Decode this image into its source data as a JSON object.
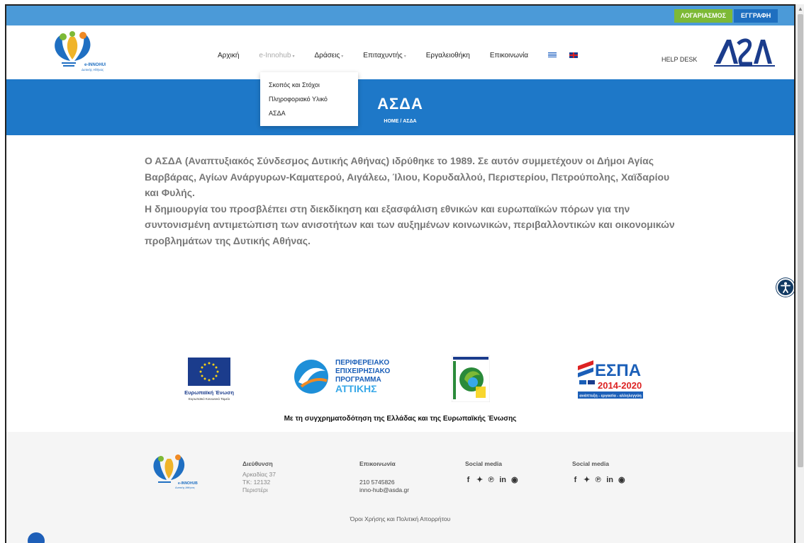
{
  "topbar": {
    "account_label": "ΛΟΓΑΡΙΑΣΜΟΣ",
    "register_label": "ΕΓΓΡΑΦΗ"
  },
  "header": {
    "logo_text": "e-INNOHUB",
    "logo_subtext": "Δυτικής Αθήνας",
    "nav": [
      {
        "label": "Αρχική"
      },
      {
        "label": "e-Innohub"
      },
      {
        "label": "Δράσεις"
      },
      {
        "label": "Επιταχυντής"
      },
      {
        "label": "Εργαλειοθήκη"
      },
      {
        "label": "Επικοινωνία"
      }
    ],
    "helpdesk_label": "HELP DESK",
    "partner_logo_text": "ΑΣΔΑ"
  },
  "dropdown": {
    "items": [
      "Σκοπός και Στόχοι",
      "Πληροφοριακό Υλικό",
      "ΑΣΔΑ"
    ]
  },
  "hero": {
    "title": "ΑΣΔΑ",
    "breadcrumb": "HOME / ΑΣΔΑ"
  },
  "content": {
    "paragraph1": "Ο ΑΣΔΑ (Αναπτυξιακός Σύνδεσμος Δυτικής Αθήνας) ιδρύθηκε το 1989. Σε αυτόν συμμετέχουν οι Δήμοι Αγίας Βαρβάρας, Αγίων Ανάργυρων-Καματερού, Αιγάλεω, Ίλιου, Κορυδαλλού, Περιστερίου, Πετρούπολης, Χαϊδαρίου και Φυλής.",
    "paragraph2": "Η δημιουργία του προσβλέπει στη διεκδίκηση και εξασφάλιση εθνικών και ευρωπαϊκών πόρων για την συντονισμένη αντιμετώπιση των ανισοτήτων και των αυξημένων κοινωνικών, περιβαλλοντικών και οικονομικών προβλημάτων της Δυτικής Αθήνας."
  },
  "sponsors": {
    "eu_title": "Ευρωπαϊκή Ένωση",
    "eu_subtitle": "Ευρωπαϊκό Κοινωνικό Ταμείο",
    "pep_line1": "ΠΕΡΙΦΕΡΕΙΑΚΟ",
    "pep_line2": "ΕΠΙΧΕΙΡΗΣΙΑΚΟ",
    "pep_line3": "ΠΡΟΓΡΑΜΜΑ",
    "pep_line4": "ΑΤΤΙΚΗΣ",
    "espa_title": "ΕΣΠΑ",
    "espa_years": "2014-2020",
    "espa_tagline": "ανάπτυξη - εργασία - αλληλεγγύη",
    "cofund_text": "Με τη συγχρηματοδότηση της Ελλάδας και της Ευρωπαϊκής Ένωσης"
  },
  "footer": {
    "address": {
      "heading": "Διεύθυνση",
      "lines": [
        "Αρκαδίας 37",
        "ΤΚ: 12132",
        "Περιστέρι"
      ]
    },
    "contact": {
      "heading": "Επικοινωνία",
      "phone": "210 5745826",
      "email": "inno-hub@asda.gr"
    },
    "social1": {
      "heading": "Social media"
    },
    "social2": {
      "heading": "Social media"
    },
    "terms": "Όροι Χρήσης και Πολιτική Απορρήτου"
  },
  "colors": {
    "topbar": "#4b9ad8",
    "hero": "#1e78c8",
    "account_btn": "#7db936",
    "register_btn": "#1e6fc0"
  },
  "icons": [
    "facebook-icon",
    "twitter-icon",
    "pinterest-icon",
    "linkedin-icon",
    "telegram-icon",
    "accessibility-icon",
    "greek-flag-icon",
    "uk-flag-icon"
  ]
}
